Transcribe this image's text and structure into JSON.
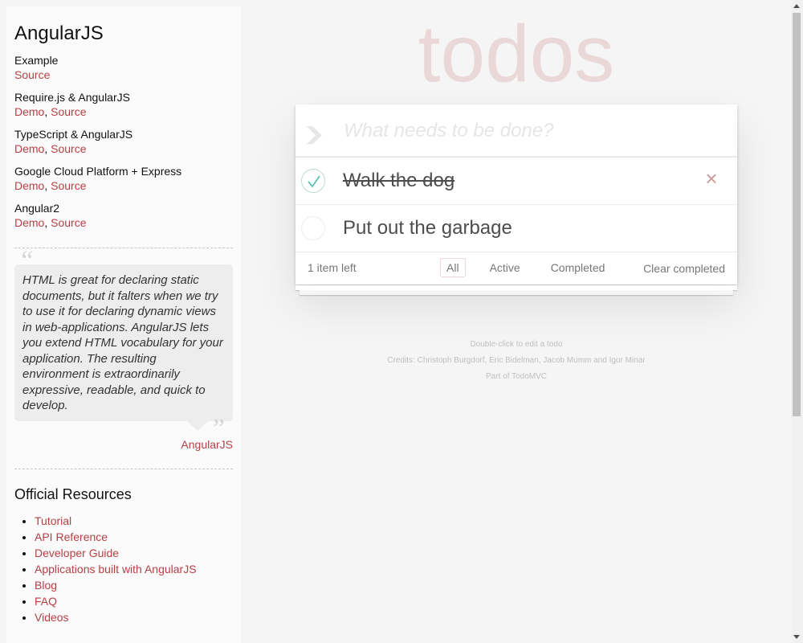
{
  "sidebar": {
    "title": "AngularJS",
    "examples": [
      {
        "title": "Example",
        "links": [
          {
            "label": "Source"
          }
        ]
      },
      {
        "title": "Require.js & AngularJS",
        "links": [
          {
            "label": "Demo"
          },
          {
            "label": "Source"
          }
        ]
      },
      {
        "title": "TypeScript & AngularJS",
        "links": [
          {
            "label": "Demo"
          },
          {
            "label": "Source"
          }
        ]
      },
      {
        "title": "Google Cloud Platform + Express",
        "links": [
          {
            "label": "Demo"
          },
          {
            "label": "Source"
          }
        ]
      },
      {
        "title": "Angular2",
        "links": [
          {
            "label": "Demo"
          },
          {
            "label": "Source"
          }
        ]
      }
    ],
    "quote": {
      "text": "HTML is great for declaring static documents, but it falters when we try to use it for declaring dynamic views in web-applications. AngularJS lets you extend HTML vocabulary for your application. The resulting environment is extraordinarily expressive, readable, and quick to develop.",
      "open_mark": "“",
      "close_mark": "”",
      "source": "AngularJS"
    },
    "resources_title": "Official Resources",
    "resources": [
      "Tutorial",
      "API Reference",
      "Developer Guide",
      "Applications built with AngularJS",
      "Blog",
      "FAQ",
      "Videos"
    ]
  },
  "app": {
    "title": "todos",
    "new_todo_placeholder": "What needs to be done?",
    "toggle_all_icon": "chevron-down-icon",
    "todos": [
      {
        "title": "Walk the dog",
        "completed": true
      },
      {
        "title": "Put out the garbage",
        "completed": false
      }
    ],
    "footer": {
      "count_text": "1 item left",
      "filters": [
        "All",
        "Active",
        "Completed"
      ],
      "selected_filter": "All",
      "clear_label": "Clear completed"
    }
  },
  "info": {
    "edit_hint": "Double-click to edit a todo",
    "credits": "Credits: Christoph Burgdorf, Eric Bidelman, Jacob Mumm and Igor Minar",
    "part_of": "Part of TodoMVC"
  },
  "colors": {
    "accent": "#b83f45",
    "title": "rgba(175,47,47,0.15)",
    "check_green": "#5dc2af",
    "destroy": "#cc9a9a"
  }
}
